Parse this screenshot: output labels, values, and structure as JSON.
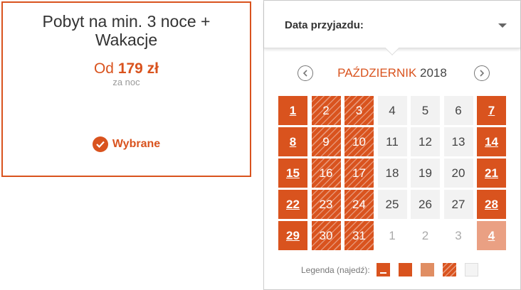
{
  "offer": {
    "title": "Pobyt na min. 3 noce + Wakacje",
    "price_prefix": "Od",
    "price_amount": "179 zł",
    "per_label": "za noc",
    "selected_label": "Wybrane"
  },
  "calendar": {
    "header_label": "Data przyjazdu:",
    "month": "PAŹDZIERNIK",
    "year": "2018",
    "days": [
      {
        "label": "1",
        "status": "full"
      },
      {
        "label": "2",
        "status": "hatched"
      },
      {
        "label": "3",
        "status": "hatched"
      },
      {
        "label": "4",
        "status": "free"
      },
      {
        "label": "5",
        "status": "free"
      },
      {
        "label": "6",
        "status": "free"
      },
      {
        "label": "7",
        "status": "full"
      },
      {
        "label": "8",
        "status": "full"
      },
      {
        "label": "9",
        "status": "hatched"
      },
      {
        "label": "10",
        "status": "hatched"
      },
      {
        "label": "11",
        "status": "free"
      },
      {
        "label": "12",
        "status": "free"
      },
      {
        "label": "13",
        "status": "free"
      },
      {
        "label": "14",
        "status": "full"
      },
      {
        "label": "15",
        "status": "full"
      },
      {
        "label": "16",
        "status": "hatched"
      },
      {
        "label": "17",
        "status": "hatched"
      },
      {
        "label": "18",
        "status": "free"
      },
      {
        "label": "19",
        "status": "free"
      },
      {
        "label": "20",
        "status": "free"
      },
      {
        "label": "21",
        "status": "full"
      },
      {
        "label": "22",
        "status": "full"
      },
      {
        "label": "23",
        "status": "hatched"
      },
      {
        "label": "24",
        "status": "hatched"
      },
      {
        "label": "25",
        "status": "free"
      },
      {
        "label": "26",
        "status": "free"
      },
      {
        "label": "27",
        "status": "free"
      },
      {
        "label": "28",
        "status": "full"
      },
      {
        "label": "29",
        "status": "full"
      },
      {
        "label": "30",
        "status": "hatched"
      },
      {
        "label": "31",
        "status": "hatched"
      },
      {
        "label": "1",
        "status": "next"
      },
      {
        "label": "2",
        "status": "next"
      },
      {
        "label": "3",
        "status": "next"
      },
      {
        "label": "4",
        "status": "next-full"
      }
    ],
    "legend_label": "Legenda (najedź):",
    "legend_items": [
      "underlined",
      "solid",
      "light",
      "hatched",
      "empty"
    ]
  },
  "colors": {
    "accent": "#d9531e",
    "free_day": "#f2f2f2"
  }
}
